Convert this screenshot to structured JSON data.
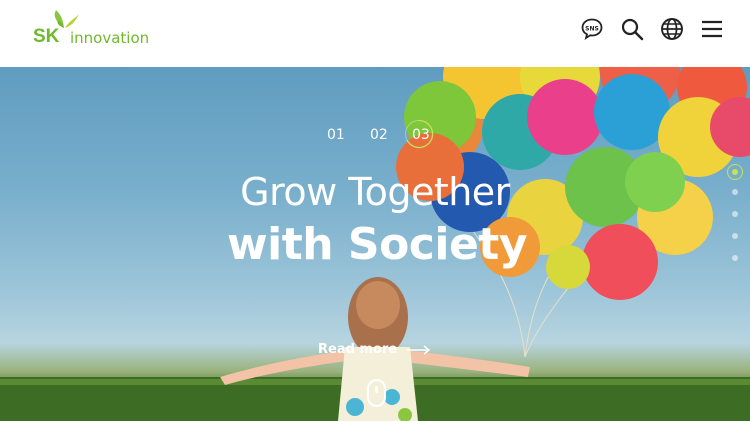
{
  "header": {
    "logo_sk": "SK",
    "logo_word": "innovation",
    "icons": {
      "sns_label": "SNS",
      "sns": "sns-chat-icon",
      "search": "search-icon",
      "language": "globe-icon",
      "menu": "hamburger-menu-icon"
    }
  },
  "hero": {
    "slides": [
      "01",
      "02",
      "03"
    ],
    "active_slide": "03",
    "headline_line1": "Grow Together",
    "headline_line2": "with Society",
    "read_more": "Read more",
    "side_pagination_count": 5,
    "side_pagination_active": 1
  },
  "colors": {
    "brand_green": "#6fb92c",
    "accent_lime": "#c7e05a",
    "text_white": "#ffffff"
  }
}
